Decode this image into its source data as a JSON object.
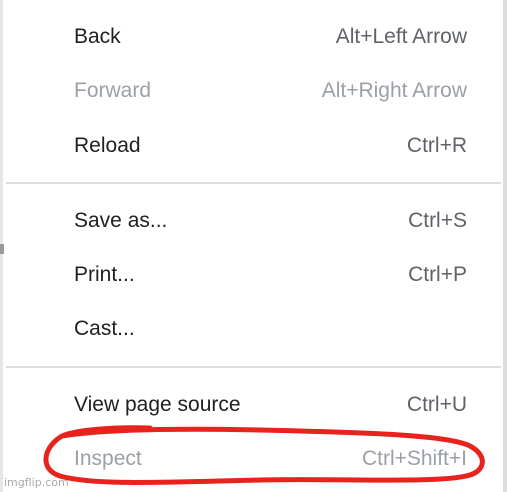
{
  "context_menu": {
    "items": [
      {
        "label": "Back",
        "shortcut": "Alt+Left Arrow",
        "enabled": true
      },
      {
        "label": "Forward",
        "shortcut": "Alt+Right Arrow",
        "enabled": false
      },
      {
        "label": "Reload",
        "shortcut": "Ctrl+R",
        "enabled": true
      },
      {
        "label": "Save as...",
        "shortcut": "Ctrl+S",
        "enabled": true
      },
      {
        "label": "Print...",
        "shortcut": "Ctrl+P",
        "enabled": true
      },
      {
        "label": "Cast...",
        "shortcut": "",
        "enabled": true
      },
      {
        "label": "View page source",
        "shortcut": "Ctrl+U",
        "enabled": true
      },
      {
        "label": "Inspect",
        "shortcut": "Ctrl+Shift+I",
        "enabled": false
      }
    ]
  },
  "annotation": {
    "color": "#e8231e",
    "target": "Inspect"
  },
  "watermark": {
    "text": "imgflip.com"
  },
  "colors": {
    "text_enabled": "#202124",
    "text_shortcut": "#5f6368",
    "text_disabled": "#9aa0a6",
    "separator": "#dadce0"
  }
}
